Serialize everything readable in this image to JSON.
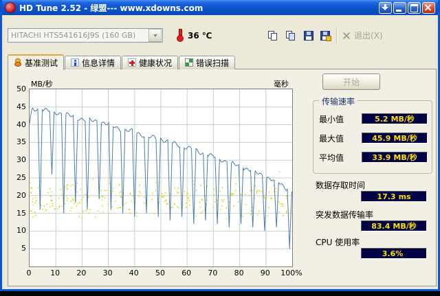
{
  "window": {
    "title": "HD Tune 2.52 - 绿盟--- www.xdowns.com"
  },
  "toolbar": {
    "drive_select": "HITACHI HTS541616J9S (160 GB)",
    "temperature": "36 ℃",
    "exit_label": "退出(X)"
  },
  "tabs": [
    {
      "label": "基准测试"
    },
    {
      "label": "信息详情"
    },
    {
      "label": "健康状况"
    },
    {
      "label": "错误扫描"
    }
  ],
  "panel": {
    "start_button": "开始",
    "transfer_group": {
      "title": "传输速率",
      "rows": [
        {
          "label": "最小值",
          "value": "5.2",
          "unit": "MB/秒"
        },
        {
          "label": "最大值",
          "value": "45.9",
          "unit": "MB/秒"
        },
        {
          "label": "平均值",
          "value": "33.9",
          "unit": "MB/秒"
        }
      ]
    },
    "stats": [
      {
        "label": "数据存取时间",
        "value": "17.3",
        "unit": "ms"
      },
      {
        "label": "突发数据传输率",
        "value": "83.4",
        "unit": "MB/秒"
      },
      {
        "label": "CPU 使用率",
        "value": "3.6%",
        "unit": ""
      }
    ]
  },
  "chart_data": {
    "type": "line",
    "title": "HD Tune benchmark: transfer rate (blue line) and access time dots (yellow)",
    "y_left": {
      "label": "MB/秒",
      "min": 0,
      "max": 50,
      "ticks": [
        50,
        45,
        40,
        35,
        30,
        25,
        20,
        15,
        10,
        5
      ]
    },
    "y_right": {
      "label": "毫秒"
    },
    "x_axis": {
      "min": 0,
      "max": 100,
      "ticks": [
        "0",
        "10",
        "20",
        "30",
        "40",
        "50",
        "60",
        "70",
        "80",
        "90",
        "100%"
      ]
    },
    "transfer_envelope": [
      [
        0,
        40
      ],
      [
        1,
        44.5
      ],
      [
        5,
        44.2
      ],
      [
        10,
        43.5
      ],
      [
        15,
        42.6
      ],
      [
        20,
        41.6
      ],
      [
        25,
        41
      ],
      [
        30,
        40.2
      ],
      [
        35,
        38.6
      ],
      [
        40,
        38
      ],
      [
        45,
        36.6
      ],
      [
        50,
        36
      ],
      [
        55,
        34.6
      ],
      [
        60,
        33.6
      ],
      [
        65,
        32.2
      ],
      [
        70,
        31
      ],
      [
        75,
        29.6
      ],
      [
        80,
        28.2
      ],
      [
        85,
        27
      ],
      [
        90,
        25.2
      ],
      [
        95,
        23.6
      ],
      [
        100,
        21
      ]
    ],
    "spikes": [
      {
        "x": 4,
        "low": 16
      },
      {
        "x": 8.5,
        "low": 26
      },
      {
        "x": 13,
        "low": 15
      },
      {
        "x": 17.5,
        "low": 18
      },
      {
        "x": 22,
        "low": 16
      },
      {
        "x": 26.5,
        "low": 19
      },
      {
        "x": 31,
        "low": 16
      },
      {
        "x": 35.5,
        "low": 15
      },
      {
        "x": 40,
        "low": 14
      },
      {
        "x": 44.5,
        "low": 15
      },
      {
        "x": 49,
        "low": 14
      },
      {
        "x": 53.5,
        "low": 13
      },
      {
        "x": 58,
        "low": 14
      },
      {
        "x": 62.5,
        "low": 12
      },
      {
        "x": 67,
        "low": 13
      },
      {
        "x": 71.5,
        "low": 12
      },
      {
        "x": 76,
        "low": 11
      },
      {
        "x": 80.5,
        "low": 12
      },
      {
        "x": 85,
        "low": 11
      },
      {
        "x": 89.5,
        "low": 10
      },
      {
        "x": 94,
        "low": 11
      },
      {
        "x": 99,
        "low": 5
      }
    ],
    "summary": {
      "min": "5.2 MB/秒",
      "max": "45.9 MB/秒",
      "avg": "33.9 MB/秒",
      "access_time": "17.3 ms",
      "burst_rate": "83.4 MB/秒",
      "cpu": "3.6%"
    },
    "access_dots": {
      "count": 290,
      "y_min": 13,
      "y_max": 25,
      "seed": 11
    },
    "colors": {
      "line": "#4a7ab2",
      "dots": "#d9d900",
      "grid": "#c2d4c2",
      "plot_bg": "#ffffff",
      "value_bg": "#000045",
      "value_text": "#ffdf00"
    }
  }
}
